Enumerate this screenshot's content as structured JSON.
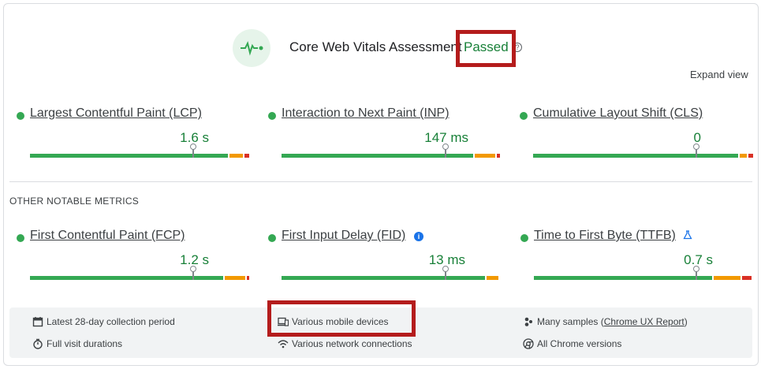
{
  "header": {
    "title": "Core Web Vitals Assessment",
    "status": "Passed",
    "help_glyph": "?",
    "expand_label": "Expand view"
  },
  "colors": {
    "good": "#34a853",
    "needs_improvement": "#f29900",
    "poor": "#d93025",
    "passed_text": "#188038",
    "highlight": "#b41c1c"
  },
  "core_metrics": [
    {
      "name": "Largest Contentful Paint (LCP)",
      "value": "1.6 s",
      "status": "good"
    },
    {
      "name": "Interaction to Next Paint (INP)",
      "value": "147 ms",
      "status": "good"
    },
    {
      "name": "Cumulative Layout Shift (CLS)",
      "value": "0",
      "status": "good"
    }
  ],
  "other_section_title": "OTHER NOTABLE METRICS",
  "other_metrics": [
    {
      "name": "First Contentful Paint (FCP)",
      "value": "1.2 s",
      "status": "good"
    },
    {
      "name": "First Input Delay (FID)",
      "value": "13 ms",
      "status": "good",
      "badge": "i"
    },
    {
      "name": "Time to First Byte (TTFB)",
      "value": "0.7 s",
      "status": "good",
      "badge": "flask-icon"
    }
  ],
  "footer": {
    "collection_period": "Latest 28-day collection period",
    "visit_durations": "Full visit durations",
    "devices": "Various mobile devices",
    "network": "Various network connections",
    "samples_prefix": "Many samples (",
    "samples_link": "Chrome UX Report",
    "samples_suffix": ")",
    "chrome_versions": "All Chrome versions"
  }
}
